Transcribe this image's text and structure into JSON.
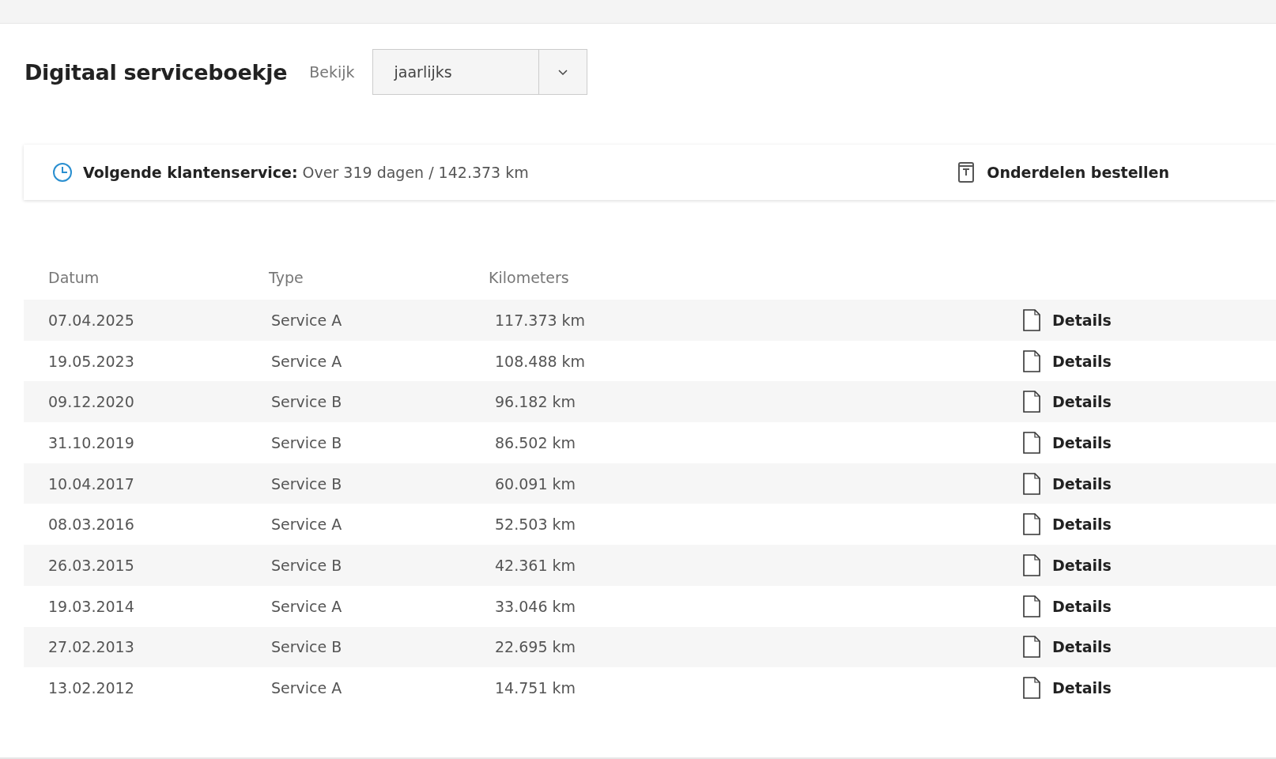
{
  "header": {
    "title": "Digitaal serviceboekje",
    "view_label": "Bekijk",
    "view_select": {
      "value": "jaarlijks"
    }
  },
  "banner": {
    "label": "Volgende klantenservice:",
    "value": "Over 319 dagen / 142.373 km",
    "action": "Onderdelen bestellen"
  },
  "table": {
    "columns": [
      "Datum",
      "Type",
      "Kilometers"
    ],
    "rows": [
      {
        "date": "07.04.2025",
        "type": "Service A",
        "km": "117.373 km",
        "action": "Details"
      },
      {
        "date": "19.05.2023",
        "type": "Service A",
        "km": "108.488 km",
        "action": "Details"
      },
      {
        "date": "09.12.2020",
        "type": "Service B",
        "km": "96.182 km",
        "action": "Details"
      },
      {
        "date": "31.10.2019",
        "type": "Service B",
        "km": "86.502 km",
        "action": "Details"
      },
      {
        "date": "10.04.2017",
        "type": "Service B",
        "km": "60.091 km",
        "action": "Details"
      },
      {
        "date": "08.03.2016",
        "type": "Service A",
        "km": "52.503 km",
        "action": "Details"
      },
      {
        "date": "26.03.2015",
        "type": "Service B",
        "km": "42.361 km",
        "action": "Details"
      },
      {
        "date": "19.03.2014",
        "type": "Service A",
        "km": "33.046 km",
        "action": "Details"
      },
      {
        "date": "27.02.2013",
        "type": "Service B",
        "km": "22.695 km",
        "action": "Details"
      },
      {
        "date": "13.02.2012",
        "type": "Service A",
        "km": "14.751 km",
        "action": "Details"
      }
    ]
  }
}
